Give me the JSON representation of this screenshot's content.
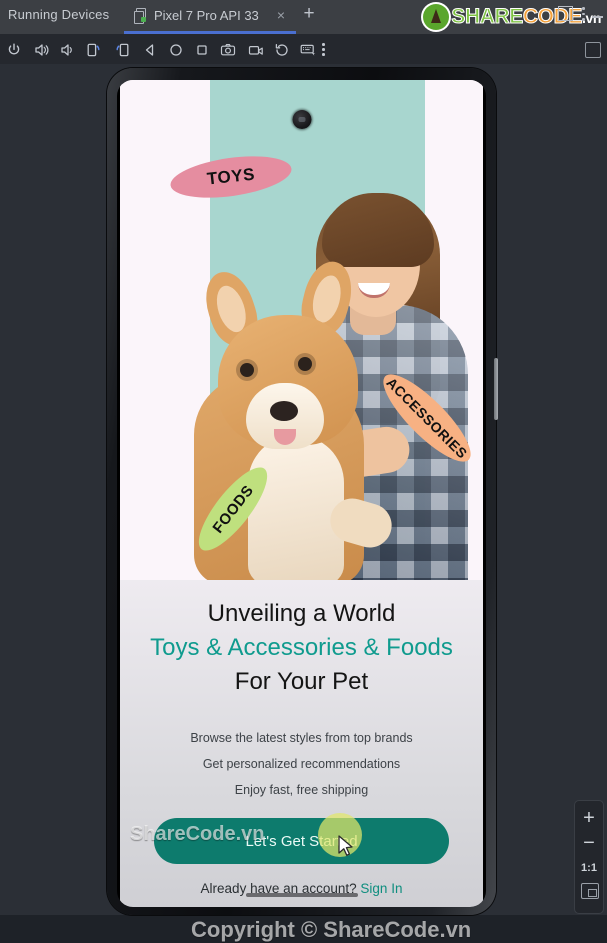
{
  "window": {
    "tool_window_title": "Running Devices",
    "controls": {
      "minimize": "minimize-icon",
      "maximize": "maximize-icon",
      "more": "more-options-icon"
    }
  },
  "tabs": [
    {
      "label": "Pixel 7 Pro API 33",
      "icon": "device-icon",
      "close": "×",
      "active": true
    }
  ],
  "new_tab_label": "+",
  "toolbar": {
    "items": [
      {
        "name": "power-button",
        "icon": "power-icon"
      },
      {
        "name": "volume-up-button",
        "icon": "volume-up-icon"
      },
      {
        "name": "volume-down-button",
        "icon": "volume-down-icon"
      },
      {
        "name": "rotate-left-button",
        "icon": "rotate-left-icon"
      },
      {
        "name": "rotate-right-button",
        "icon": "rotate-right-icon"
      },
      {
        "name": "back-button",
        "icon": "back-triangle-icon"
      },
      {
        "name": "home-button",
        "icon": "home-circle-icon"
      },
      {
        "name": "overview-button",
        "icon": "overview-square-icon"
      },
      {
        "name": "screenshot-button",
        "icon": "camera-icon"
      },
      {
        "name": "screen-record-button",
        "icon": "video-camera-icon"
      },
      {
        "name": "rotate-history-button",
        "icon": "history-rotate-icon"
      },
      {
        "name": "keyboard-input-button",
        "icon": "keyboard-icon"
      },
      {
        "name": "more-actions-button",
        "icon": "vertical-dots-icon"
      }
    ],
    "right_action": "snapshot-icon"
  },
  "branding": {
    "logo_share": "SHARE",
    "logo_code": "CODE",
    "logo_vn": ".vn",
    "watermark_middle": "ShareCode.vn",
    "watermark_bottom": "Copyright © ShareCode.vn"
  },
  "phone": {
    "device": "Pixel 7 Pro API 33",
    "app": {
      "hero": {
        "badges": [
          {
            "text": "TOYS",
            "color": "#e58da0"
          },
          {
            "text": "ACCESSORIES",
            "color": "#f7b183"
          },
          {
            "text": "FOODS",
            "color": "#bfe07e"
          }
        ],
        "band_color": "#a8d6cf"
      },
      "headline": {
        "line1": "Unveiling a World",
        "line2": "Toys & Accessories & Foods",
        "line3": "For Your Pet",
        "accent_color": "#0f9b8e"
      },
      "features": [
        "Browse the latest styles from top brands",
        "Get personalized recommendations",
        "Enjoy fast, free shipping"
      ],
      "cta_label": "Let's Get Started",
      "cta_color": "#0d7b6d",
      "footer_prompt": "Already have an account?",
      "footer_link": "Sign In"
    }
  },
  "zoom_rail": {
    "zoom_in": "+",
    "zoom_out": "−",
    "actual_size": "1:1",
    "fit_to_screen": "fit-screen-icon"
  }
}
